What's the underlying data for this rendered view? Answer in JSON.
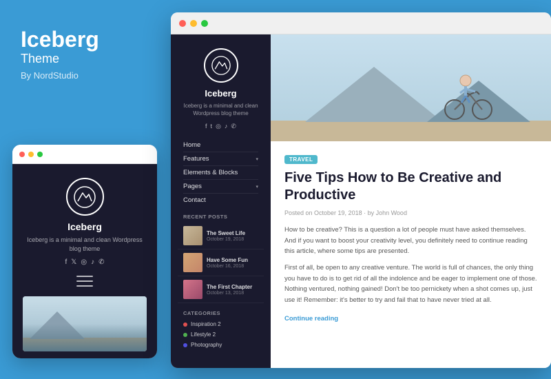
{
  "left": {
    "title": "Iceberg",
    "subtitle": "Theme",
    "by": "By NordStudio"
  },
  "mobile": {
    "brand": "Iceberg",
    "desc": "Iceberg is a minimal and clean Wordpress blog theme",
    "social_icons": [
      "f",
      "𝕏",
      "◎",
      "♪",
      "✆"
    ]
  },
  "browser": {
    "sidebar": {
      "brand": "Iceberg",
      "desc": "Iceberg is a minimal and clean Wordpress blog theme",
      "social_icons": [
        "f",
        "t",
        "◎",
        "♪",
        "✆"
      ],
      "nav": [
        {
          "label": "Home",
          "has_chevron": false
        },
        {
          "label": "Features",
          "has_chevron": true
        },
        {
          "label": "Elements & Blocks",
          "has_chevron": false
        },
        {
          "label": "Pages",
          "has_chevron": true
        },
        {
          "label": "Contact",
          "has_chevron": false
        }
      ],
      "recent_posts_title": "RECENT POSTS",
      "recent_posts": [
        {
          "title": "The Sweet Life",
          "date": "October 19, 2018"
        },
        {
          "title": "Have Some Fun",
          "date": "October 16, 2018"
        },
        {
          "title": "The First Chapter",
          "date": "October 13, 2018"
        }
      ],
      "categories_title": "CATEGORIES",
      "categories": [
        {
          "label": "Inspiration 2",
          "color": "#e05050"
        },
        {
          "label": "Lifestyle 2",
          "color": "#50b050"
        },
        {
          "label": "Photography",
          "color": "#5050e0"
        }
      ]
    },
    "article": {
      "tag": "TRAVEL",
      "title": "Five Tips How to Be Creative and Productive",
      "meta": "Posted on October 19, 2018 · by John Wood",
      "para1": "How to be creative? This is a question a lot of people must have asked themselves. And if you want to boost your creativity level, you definitely need to continue reading this article, where some tips are presented.",
      "para2": "First of all, be open to any creative venture. The world is full of chances, the only thing you have to do is to get rid of all the indolence and be eager to implement one of those. Nothing ventured, nothing gained! Don't be too pernickety when a shot comes up, just use it! Remember: it's better to try and fail that to have never tried at all.",
      "continue": "Continue reading"
    }
  }
}
